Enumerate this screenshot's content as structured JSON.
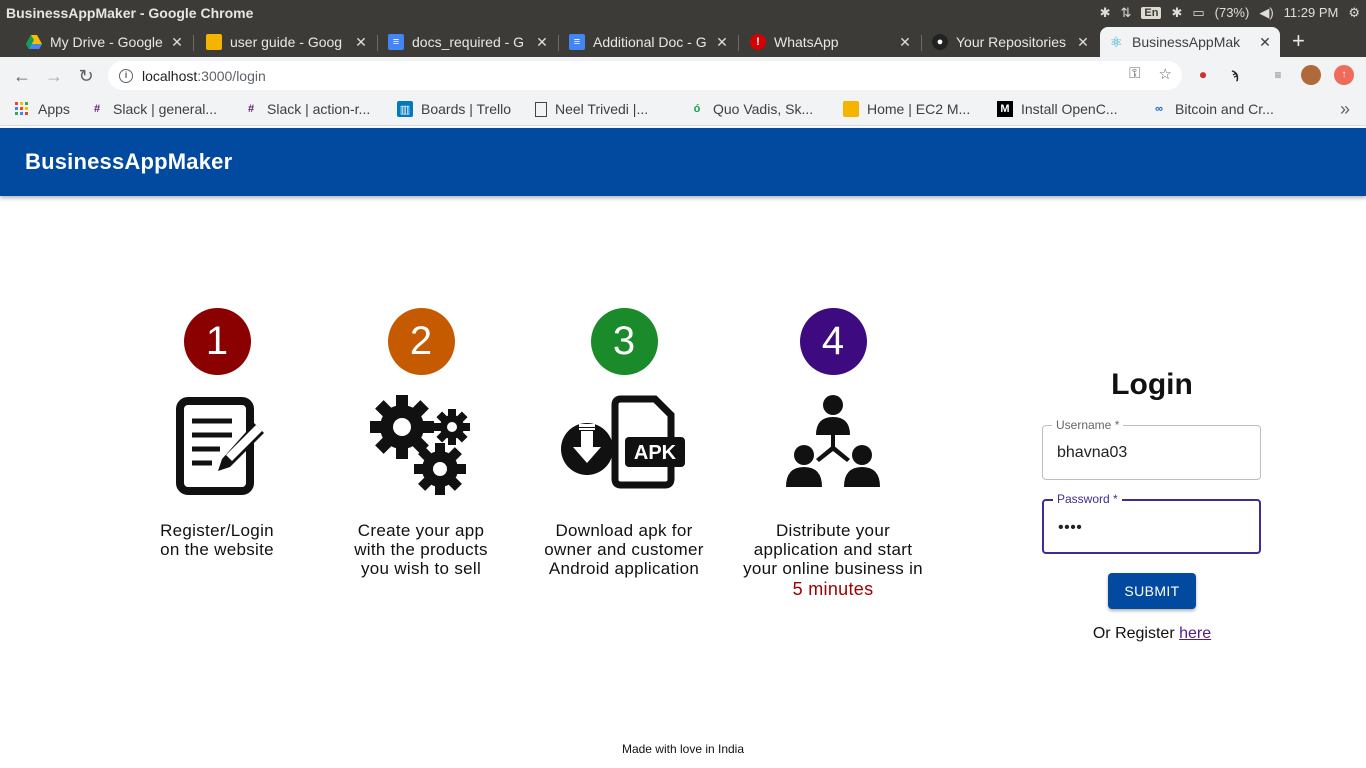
{
  "window": {
    "title": "BusinessAppMaker - Google Chrome"
  },
  "tray": {
    "language": "En",
    "battery": "(73%)",
    "time": "11:29 PM"
  },
  "tabs": [
    {
      "label": "My Drive - Google",
      "favicon": "drive-icon"
    },
    {
      "label": "user guide - Goog",
      "favicon": "slides-icon"
    },
    {
      "label": "docs_required - G",
      "favicon": "docs-icon"
    },
    {
      "label": "Additional Doc - G",
      "favicon": "docs-icon"
    },
    {
      "label": "WhatsApp",
      "favicon": "alert-icon"
    },
    {
      "label": "Your Repositories",
      "favicon": "github-icon"
    },
    {
      "label": "BusinessAppMak",
      "favicon": "react-icon",
      "active": true
    }
  ],
  "address_bar": {
    "host": "localhost",
    "path": ":3000/login"
  },
  "bookmarks": [
    {
      "label": "Apps",
      "icon": "apps-grid-icon"
    },
    {
      "label": "Slack | general...",
      "icon": "slack-icon"
    },
    {
      "label": "Slack | action-r...",
      "icon": "slack-icon"
    },
    {
      "label": "Boards | Trello",
      "icon": "trello-icon"
    },
    {
      "label": "Neel Trivedi |...",
      "icon": "page-icon"
    },
    {
      "label": "Quo Vadis, Sk...",
      "icon": "leaf-icon"
    },
    {
      "label": "Home | EC2 M...",
      "icon": "box-icon"
    },
    {
      "label": "Install OpenC...",
      "icon": "medium-icon"
    },
    {
      "label": "Bitcoin and Cr...",
      "icon": "link-icon"
    }
  ],
  "app": {
    "title": "BusinessAppMaker"
  },
  "steps": [
    {
      "number": "1",
      "color": "#8b0000",
      "icon": "register-document-icon",
      "line1": "Register/Login",
      "line2": "on the website",
      "line3": ""
    },
    {
      "number": "2",
      "color": "#c65a00",
      "icon": "gears-icon",
      "line1": "Create your app",
      "line2": "with the products",
      "line3": "you wish to sell"
    },
    {
      "number": "3",
      "color": "#1a8a2a",
      "icon": "apk-download-icon",
      "line1": "Download apk for",
      "line2": "owner and customer",
      "line3": "Android application"
    },
    {
      "number": "4",
      "color": "#3d0a80",
      "icon": "distribution-network-icon",
      "line1": "Distribute your",
      "line2": "application and start",
      "line3": "your online business in",
      "highlight": "5 minutes"
    }
  ],
  "login": {
    "title": "Login",
    "username_label": "Username *",
    "username_value": "bhavna03",
    "password_label": "Password *",
    "password_value": "••••",
    "submit_label": "SUBMIT",
    "register_prefix": "Or Register ",
    "register_link": "here"
  },
  "footer": {
    "text": "Made with love in India"
  }
}
